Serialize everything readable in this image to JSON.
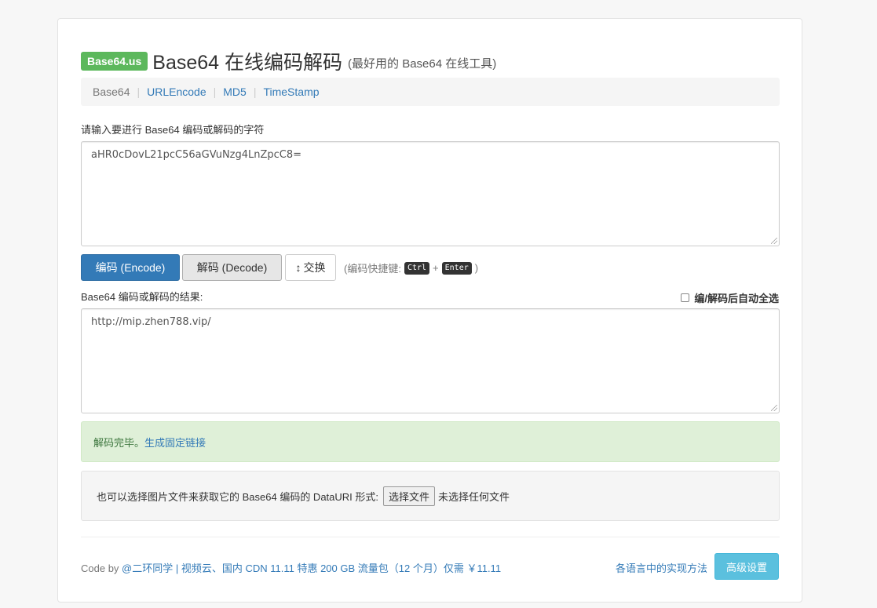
{
  "header": {
    "badge": "Base64.us",
    "title": "Base64 在线编码解码",
    "subtitle": "(最好用的 Base64 在线工具)"
  },
  "nav": {
    "items": [
      {
        "label": "Base64",
        "current": true
      },
      {
        "label": "URLEncode",
        "current": false
      },
      {
        "label": "MD5",
        "current": false
      },
      {
        "label": "TimeStamp",
        "current": false
      }
    ],
    "separator": "|"
  },
  "input": {
    "label": "请输入要进行 Base64 编码或解码的字符",
    "value": "aHR0cDovL21pcC56aGVuNzg4LnZpcC8="
  },
  "buttons": {
    "encode": "编码 (Encode)",
    "decode": "解码 (Decode)",
    "swap": "交换",
    "swap_icon": "↕"
  },
  "hint": {
    "prefix": "(编码快捷键:",
    "key1": "Ctrl",
    "plus": "+",
    "key2": "Enter",
    "suffix": ")"
  },
  "output": {
    "label": "Base64 编码或解码的结果:",
    "value": "http://mip.zhen788.vip/",
    "auto_select_label": "编/解码后自动全选"
  },
  "alert": {
    "text": "解码完毕。",
    "link": "生成固定链接"
  },
  "file": {
    "text": "也可以选择图片文件来获取它的 Base64 编码的 DataURI 形式:",
    "button": "选择文件",
    "status": "未选择任何文件"
  },
  "footer": {
    "code_by": "Code by ",
    "author": "@二环同学",
    "sep": " | ",
    "ad": "视频云、国内 CDN 11.11 特惠 200 GB 流量包（12 个月）仅需 ￥11.11",
    "impl_link": "各语言中的实现方法",
    "advanced": "高级设置"
  },
  "colors": {
    "primary": "#337ab7",
    "success_badge": "#5cb85c",
    "info": "#5bc0de",
    "alert_bg": "#dff0d8"
  }
}
